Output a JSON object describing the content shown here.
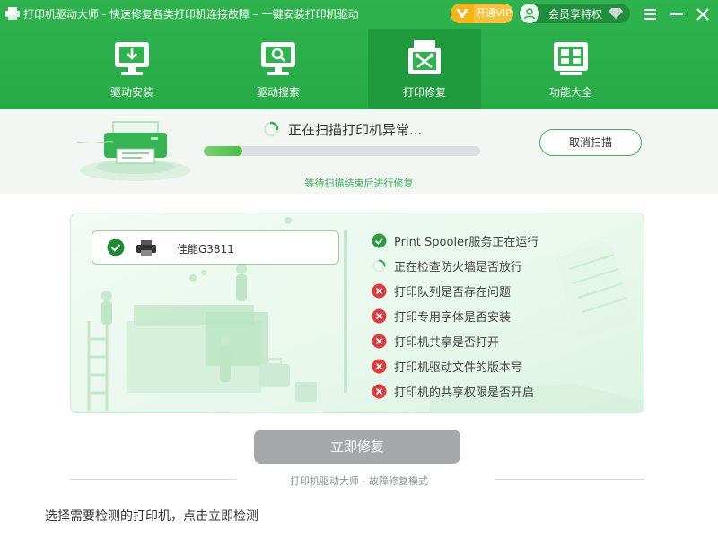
{
  "window": {
    "title": "打印机驱动大师 - 快速修复各类打印机连接故障 – 一键安装打印机驱动",
    "vip_label": "开通VIP",
    "member_label": "会员享特权"
  },
  "nav": {
    "tabs": [
      {
        "label": "驱动安装",
        "icon": "download-monitor-icon"
      },
      {
        "label": "驱动搜索",
        "icon": "search-monitor-icon"
      },
      {
        "label": "打印修复",
        "icon": "repair-tools-icon",
        "active": true
      },
      {
        "label": "功能大全",
        "icon": "apps-grid-icon"
      }
    ]
  },
  "scan": {
    "status": "正在扫描打印机异常...",
    "progress": 0.14,
    "cancel_label": "取消扫描",
    "wait_note": "等待扫描结束后进行修复"
  },
  "printers": [
    {
      "name": "佳能G3811",
      "selected": true
    }
  ],
  "checks": [
    {
      "label": "Print Spooler服务正在运行",
      "status": "ok"
    },
    {
      "label": "正在检查防火墙是否放行",
      "status": "loading"
    },
    {
      "label": "打印队列是否存在问题",
      "status": "error"
    },
    {
      "label": "打印专用字体是否安装",
      "status": "error"
    },
    {
      "label": "打印机共享是否打开",
      "status": "error"
    },
    {
      "label": "打印机驱动文件的版本号",
      "status": "error"
    },
    {
      "label": "打印机的共享权限是否开启",
      "status": "error"
    }
  ],
  "repair_label": "立即修复",
  "footer_caption": "打印机驱动大师 - 故障修复模式",
  "hint": "选择需要检测的打印机，点击立即检测",
  "colors": {
    "brand_green": "#2fb34f",
    "active_tab": "#1f9a3d",
    "ok": "#2a9c3f",
    "error": "#e5383b",
    "disabled_button": "#a5a7aa"
  }
}
